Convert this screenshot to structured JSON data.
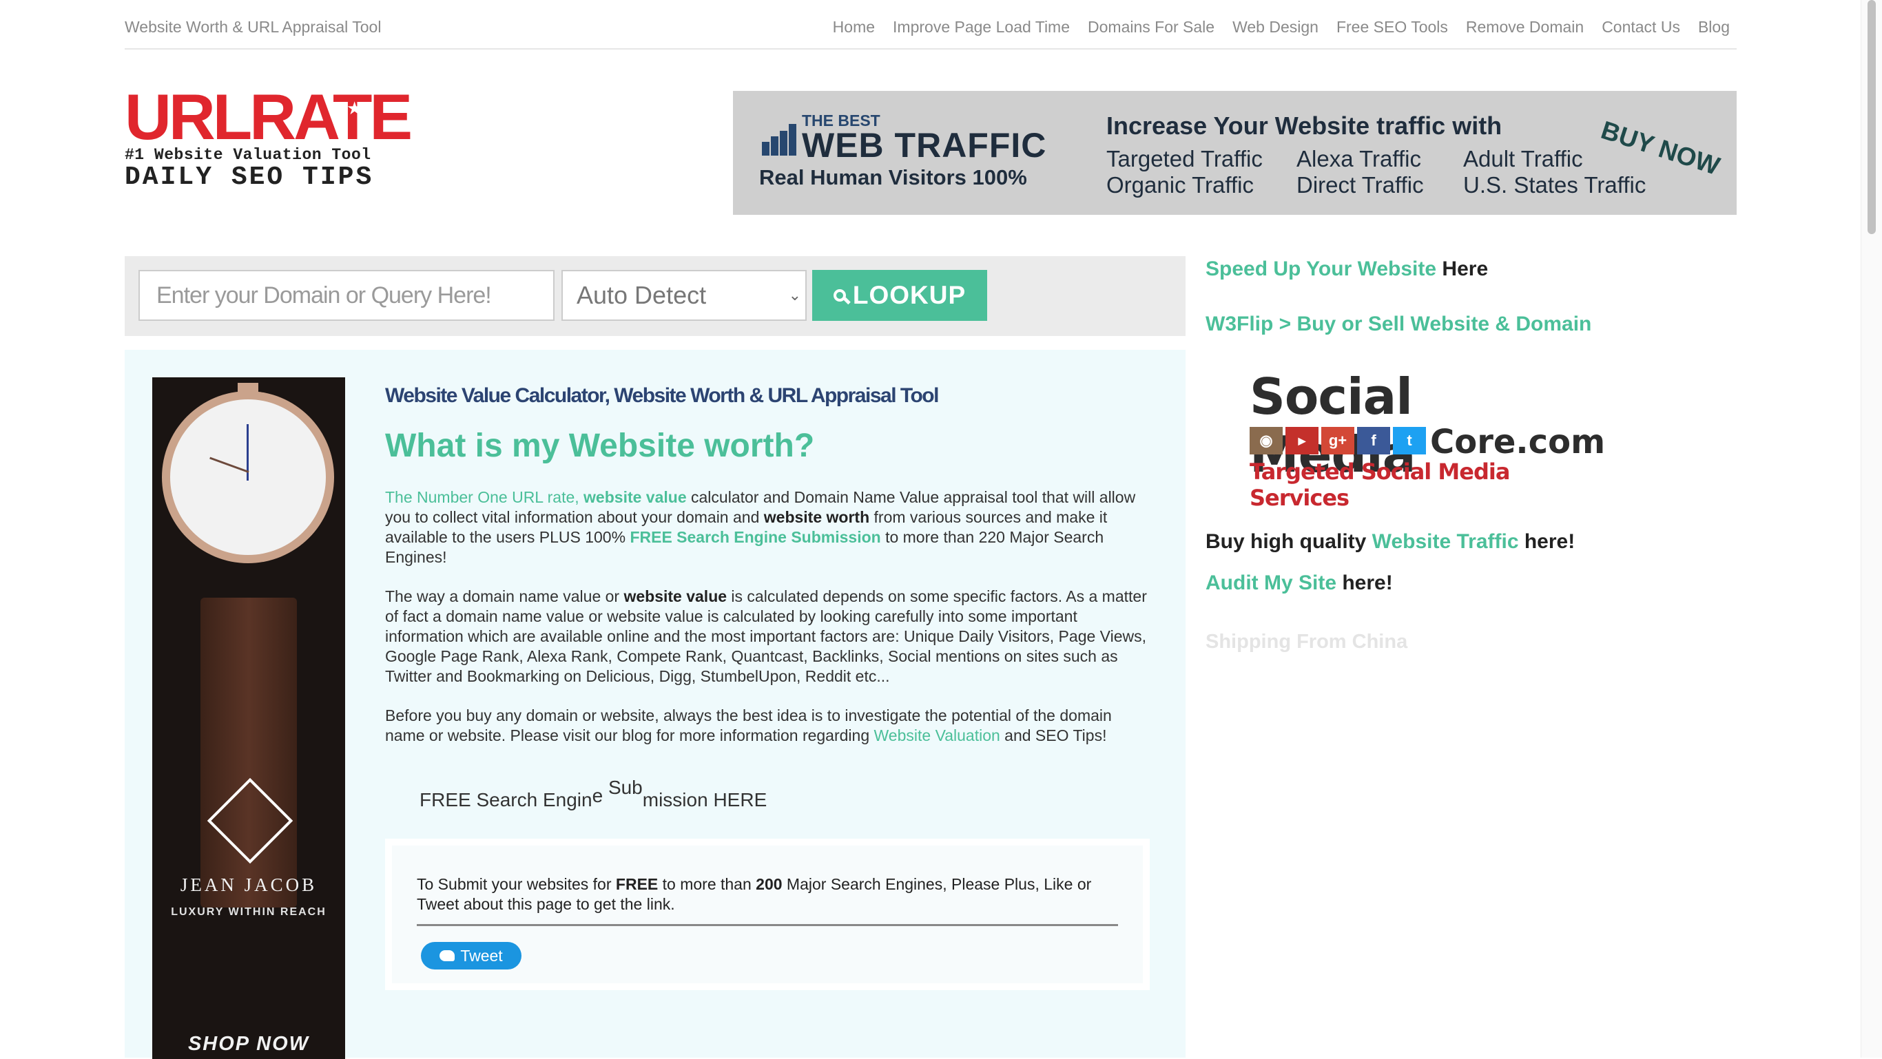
{
  "topbar": {
    "site_name": "Website Worth & URL Appraisal Tool",
    "nav": [
      "Home",
      "Improve Page Load Time",
      "Domains For Sale",
      "Web Design",
      "Free SEO Tools",
      "Remove Domain",
      "Contact Us",
      "Blog"
    ]
  },
  "logo": {
    "wordmark": "URLRATE",
    "tagline": "#1 Website Valuation Tool",
    "subline": "DAILY SEO TIPS"
  },
  "banner": {
    "the_best": "THE BEST",
    "web_traffic": "WEB TRAFFIC",
    "real_visitors": "Real Human Visitors 100%",
    "headline": "Increase Your Website traffic with",
    "items": [
      "Targeted Traffic",
      "Alexa Traffic",
      "Adult Traffic",
      "Organic Traffic",
      "Direct Traffic",
      "U.S. States Traffic"
    ],
    "cta": "BUY NOW"
  },
  "search": {
    "placeholder": "Enter your Domain or Query Here!",
    "select_value": "Auto Detect",
    "button_label": "LOOKUP"
  },
  "watch_ad": {
    "brand": "JEAN JACOB",
    "tagline": "LUXURY WITHIN REACH",
    "cta": "SHOP NOW"
  },
  "main": {
    "subtitle": "Website Value Calculator, Website Worth & URL Appraisal Tool",
    "title": "What is my Website worth?",
    "p1": {
      "link1": "The Number One URL rate,",
      "link2": "website value",
      "t1": " calculator and Domain Name Value appraisal tool that will allow you to collect vital information about your domain and ",
      "bold1": "website worth",
      "t2": " from various sources and make it available to the users PLUS 100% ",
      "bold2": "FREE Search Engine Submission",
      "t3": " to more than 220 Major Search Engines!"
    },
    "p2": {
      "t1": "The way a domain name value or ",
      "bold1": "website value",
      "t2": " is calculated depends on some specific factors. As a matter of fact a domain name value or website value is calculated by looking carefully into some important information which are available online and the most important factors are: Unique Daily Visitors, Page Views, Google Page Rank, Alexa Rank, Compete Rank, Quantcast, Backlinks, Social mentions on sites such as Twitter and Bookmarking on Delicious, Digg, StumbelUpon, Reddit etc..."
    },
    "p3": {
      "t1": "Before you buy any domain or website, always the best idea is to investigate the potential of the domain name or website. Please visit our blog for more information regarding ",
      "link": "Website Valuation",
      "t2": " and SEO Tips!"
    },
    "submit": {
      "title_a": "FREE Search Engin",
      "title_b": "e ",
      "title_c": "Sub",
      "title_d": "mission HERE",
      "t1": "To Submit your websites for ",
      "bold1": "FREE",
      "t2": " to more than ",
      "bold2": "200",
      "t3": " Major Search Engines, Please Plus, Like or Tweet about this page to get the link.",
      "tweet": "Tweet"
    }
  },
  "sidebar": {
    "speed_link": "Speed Up Your Website",
    "speed_here": " Here",
    "w3flip": "W3Flip > Buy or Sell Website & Domain",
    "social_ad": {
      "title": "Social Media",
      "core": "Core.com",
      "tagline": "Targeted Social Media Services",
      "icons": [
        "instagram-icon",
        "youtube-icon",
        "googleplus-icon",
        "facebook-icon",
        "twitter-icon"
      ]
    },
    "traffic_prefix": "Buy high quality ",
    "traffic_link": "Website Traffic",
    "traffic_suffix": " here!",
    "audit_link": "Audit My Site",
    "audit_suffix": " here!",
    "faded": "Shipping From China"
  },
  "colors": {
    "accent": "#4bbf99",
    "navy": "#2c4472",
    "logo_red": "#e0262d",
    "panel_bg": "#effafc"
  }
}
